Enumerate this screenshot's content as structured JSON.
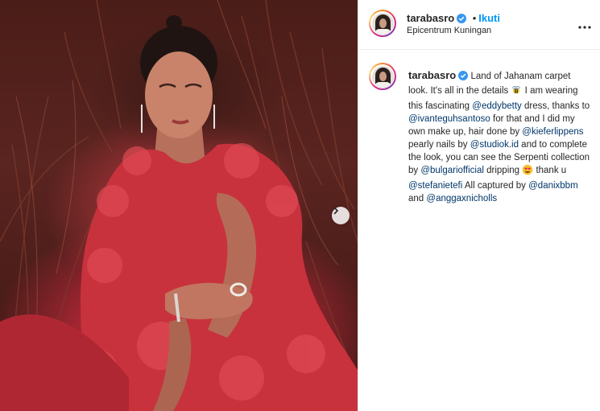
{
  "post": {
    "author": "tarabasro",
    "follow_dot": "•",
    "follow_label": "Ikuti",
    "location": "Epicentrum Kuningan",
    "more_icon": "ellipsis-icon"
  },
  "caption": {
    "username": "tarabasro",
    "t1": " Land of Jahanam carpet look. It's all in the details ",
    "t2": " I am wearing this fascinating ",
    "m1": "@eddybetty",
    "t3": " dress, thanks to ",
    "m2": "@ivanteguhsantoso",
    "t4": " for that and I did my own make up, hair done by ",
    "m3": "@kieferlippens",
    "t5": " pearly nails by ",
    "m4": "@studiok.id",
    "t6": " and to complete the look, you can see the Serpenti collection by ",
    "m5": "@bulgariofficial",
    "t7": " dripping ",
    "t8": " thank u ",
    "m6": "@stefanietefi",
    "t9": " All captured by ",
    "m7": "@danixbbm",
    "t10": " and ",
    "m8": "@anggaxnicholls"
  },
  "colors": {
    "link": "#00376b",
    "follow": "#0095f6",
    "verified": "#3897f0"
  }
}
